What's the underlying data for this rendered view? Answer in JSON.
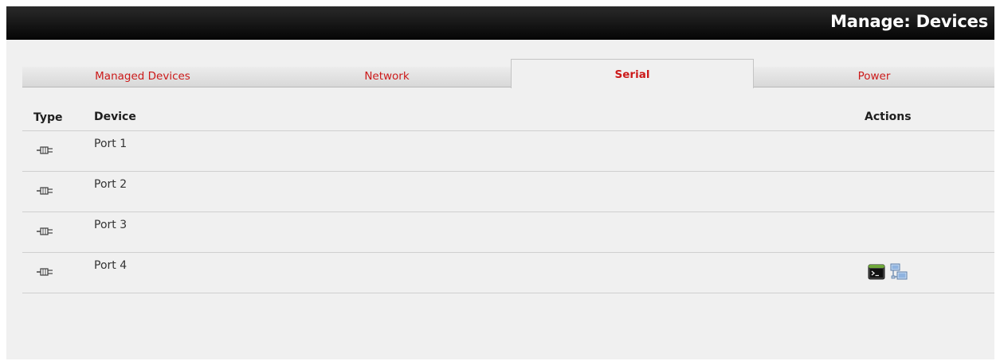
{
  "header": {
    "title": "Manage: Devices"
  },
  "tabs": [
    {
      "label": "Managed Devices",
      "active": false
    },
    {
      "label": "Network",
      "active": false
    },
    {
      "label": "Serial",
      "active": true
    },
    {
      "label": "Power",
      "active": false
    }
  ],
  "table": {
    "columns": {
      "type": "Type",
      "device": "Device",
      "actions": "Actions"
    },
    "rows": [
      {
        "device": "Port 1",
        "type_icon": "serial-connector-icon",
        "actions": []
      },
      {
        "device": "Port 2",
        "type_icon": "serial-connector-icon",
        "actions": []
      },
      {
        "device": "Port 3",
        "type_icon": "serial-connector-icon",
        "actions": []
      },
      {
        "device": "Port 4",
        "type_icon": "serial-connector-icon",
        "actions": [
          "terminal-icon",
          "network-connect-icon"
        ]
      }
    ]
  },
  "colors": {
    "accent": "#cc1a1a",
    "titlebar": "#0a0a0a",
    "background": "#f0f0f0"
  }
}
